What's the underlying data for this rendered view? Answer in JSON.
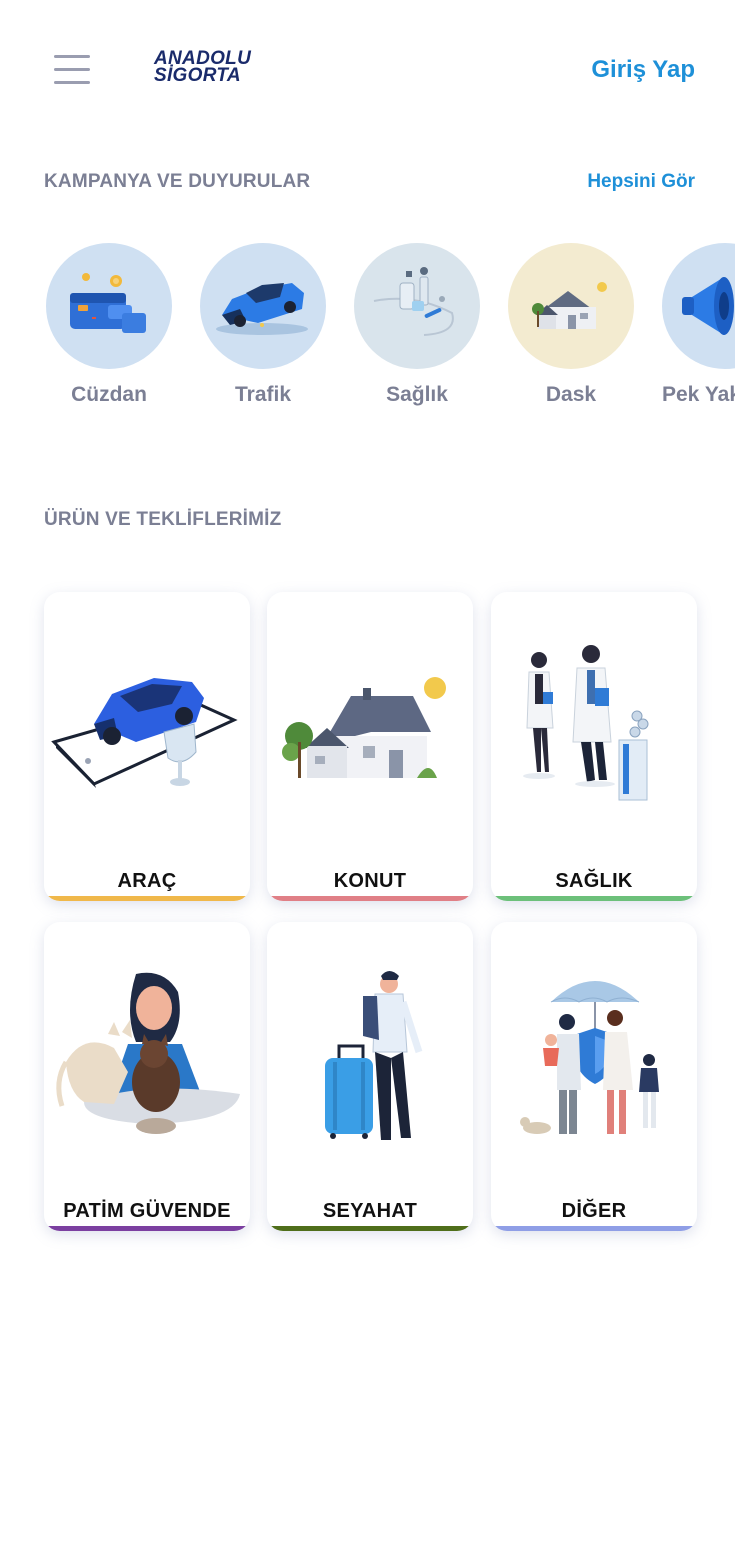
{
  "header": {
    "logo_line1": "ANADOLU",
    "logo_line2": "SİGORTA",
    "login_label": "Giriş Yap"
  },
  "campaigns": {
    "title": "KAMPANYA VE DUYURULAR",
    "see_all_label": "Hepsini Gör",
    "items": [
      {
        "label": "Cüzdan",
        "icon": "wallet-icon",
        "bg": "#cfe0f2"
      },
      {
        "label": "Trafik",
        "icon": "car-icon",
        "bg": "#cfe0f2"
      },
      {
        "label": "Sağlık",
        "icon": "health-icon",
        "bg": "#d9e4ec"
      },
      {
        "label": "Dask",
        "icon": "house-icon",
        "bg": "#f3ebd0"
      },
      {
        "label": "Pek Yakında",
        "icon": "megaphone-icon",
        "bg": "#cfe0f2"
      }
    ]
  },
  "products": {
    "title": "ÜRÜN VE TEKLİFLERİMİZ",
    "items": [
      {
        "label": "ARAÇ",
        "icon": "car-icon",
        "accent": "#f0b84a"
      },
      {
        "label": "KONUT",
        "icon": "house-icon",
        "accent": "#e07f86"
      },
      {
        "label": "SAĞLIK",
        "icon": "doctors-icon",
        "accent": "#6cc07a"
      },
      {
        "label": "PATİM GÜVENDE",
        "icon": "pet-icon",
        "accent": "#7b3fa0"
      },
      {
        "label": "SEYAHAT",
        "icon": "traveler-icon",
        "accent": "#4f6e1a"
      },
      {
        "label": "DİĞER",
        "icon": "family-umbrella-icon",
        "accent": "#8f9ee6"
      }
    ]
  },
  "colors": {
    "brand_navy": "#1a2b6b",
    "link_blue": "#1e90d8",
    "muted_text": "#7b7f94"
  }
}
